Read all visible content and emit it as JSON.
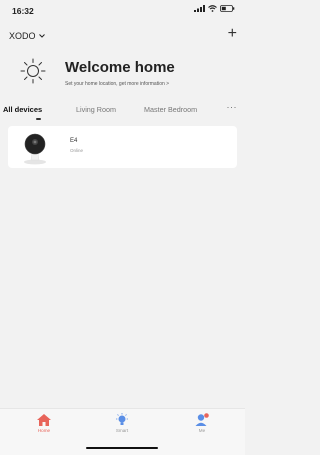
{
  "status_bar": {
    "time": "16:32"
  },
  "header": {
    "home_name": "XODO",
    "add_label": "+"
  },
  "welcome": {
    "title": "Welcome home",
    "subtitle": "Set your home location, get more information  >"
  },
  "tabs": [
    {
      "label": "All devices",
      "active": true
    },
    {
      "label": "Living Room",
      "active": false
    },
    {
      "label": "Master Bedroom",
      "active": false
    }
  ],
  "tabs_more": "···",
  "devices": [
    {
      "name": "E4",
      "status": "Online",
      "icon": "camera-icon"
    }
  ],
  "tab_bar": [
    {
      "label": "Home",
      "icon": "home-icon",
      "active": true
    },
    {
      "label": "Smart",
      "icon": "smart-icon",
      "active": false
    },
    {
      "label": "Me",
      "icon": "me-icon",
      "active": false
    }
  ],
  "colors": {
    "accent": "#e8645a",
    "smart_blue": "#5a8ee6",
    "background": "#f2f2f2"
  }
}
